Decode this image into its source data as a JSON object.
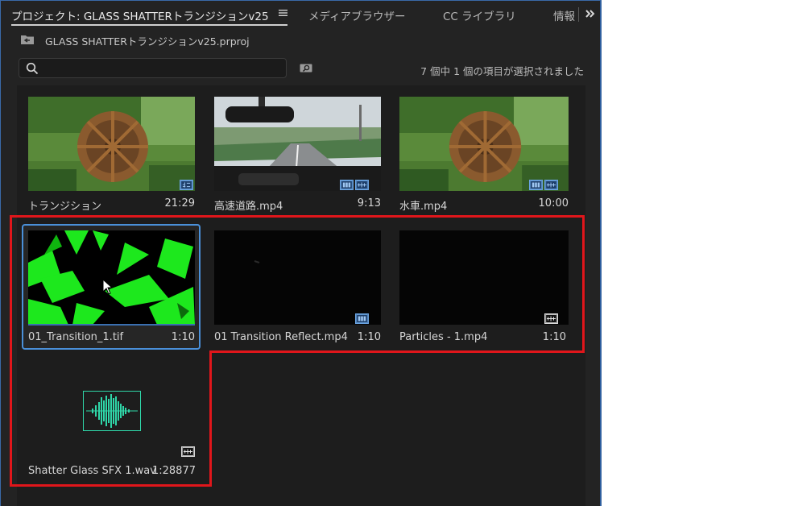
{
  "tabs": {
    "project": "プロジェクト: GLASS SHATTERトランジションv25",
    "media_browser": "メディアブラウザー",
    "cc_library": "CC ライブラリ",
    "info": "情報"
  },
  "path": {
    "project_file": "GLASS SHATTERトランジションv25.prproj"
  },
  "search": {
    "value": "",
    "placeholder": ""
  },
  "status": "7 個中 1 個の項目が選択されました",
  "items": [
    {
      "name": "トランジション",
      "duration": "21:29",
      "kind": "sequence",
      "thumbnail": "waterwheel"
    },
    {
      "name": "高速道路.mp4",
      "duration": "9:13",
      "kind": "video+audio",
      "thumbnail": "highway"
    },
    {
      "name": "水車.mp4",
      "duration": "10:00",
      "kind": "video+audio",
      "thumbnail": "waterwheel"
    },
    {
      "name": "01_Transition_1.tif",
      "duration": "1:10",
      "kind": "image",
      "thumbnail": "green-shards",
      "selected": true
    },
    {
      "name": "01 Transition Reflect.mp4",
      "duration": "1:10",
      "kind": "video",
      "thumbnail": "black"
    },
    {
      "name": "Particles - 1.mp4",
      "duration": "1:10",
      "kind": "audio",
      "thumbnail": "black"
    },
    {
      "name": "Shatter Glass SFX 1.wav",
      "duration": "1:28877",
      "kind": "audio",
      "thumbnail": "waveform"
    }
  ],
  "colors": {
    "panel_bg": "#232323",
    "grid_bg": "#1d1d1d",
    "selection": "#4a90d9",
    "annotation": "#e0161b",
    "waveform": "#2fd6a8",
    "badge": "#6aa3e0"
  },
  "icons": [
    "panel-menu-icon",
    "overflow-chevrons-icon",
    "folder-up-icon",
    "search-icon",
    "find-icon",
    "sequence-badge-icon",
    "video-badge-icon",
    "audio-badge-icon",
    "waveform-icon",
    "mouse-cursor-icon"
  ]
}
